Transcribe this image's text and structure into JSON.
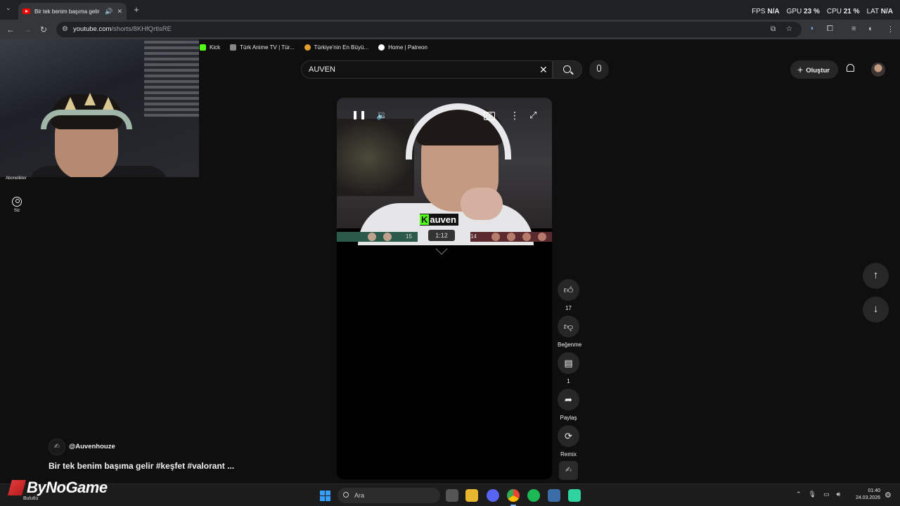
{
  "browser": {
    "tab_title": "Bir tek benim başıma gelir #",
    "url_host": "youtube.com",
    "url_path": "/shorts/8KHfQrtlsRE",
    "bookmarks": [
      {
        "label": "Kick",
        "color": "#53fc18"
      },
      {
        "label": "Türk Anime TV | Tür...",
        "color": "#888888"
      },
      {
        "label": "Türkiye'nin En Büyü...",
        "color": "#e0a030"
      },
      {
        "label": "Home | Patreon",
        "color": "#ffffff"
      }
    ]
  },
  "overlay_stats": {
    "fps_label": "FPS",
    "fps_value": "N/A",
    "gpu_label": "GPU",
    "gpu_value": "23",
    "cpu_label": "CPU",
    "cpu_value": "21",
    "lat_label": "LAT",
    "lat_value": "N/A",
    "unit": "%"
  },
  "webcam": {
    "label": "Abonelikler"
  },
  "sidebar": {
    "you_label": "Siz"
  },
  "youtube": {
    "search_value": "AUVEN",
    "create_label": "Oluştur"
  },
  "player": {
    "streamer_tag": "auven",
    "timer": "1:12",
    "score_left": "15",
    "score_right": "14",
    "cc_label": "CC"
  },
  "actions": {
    "like_count": "17",
    "dislike_label": "Beğenme",
    "comment_count": "1",
    "share_label": "Paylaş",
    "remix_label": "Remix"
  },
  "channel": {
    "handle": "@Auvenhouze",
    "title": "Bir tek benim başıma gelir #keşfet #valorant ..."
  },
  "taskbar": {
    "brand": "ByNoGame",
    "weather": "Bulutlu",
    "search_placeholder": "Ara",
    "time": "01:40",
    "date": "24.03.2026"
  },
  "colors": {
    "yt_bg": "#0f0f0f",
    "kick_green": "#53fc18",
    "youtube_red": "#ff0000"
  }
}
